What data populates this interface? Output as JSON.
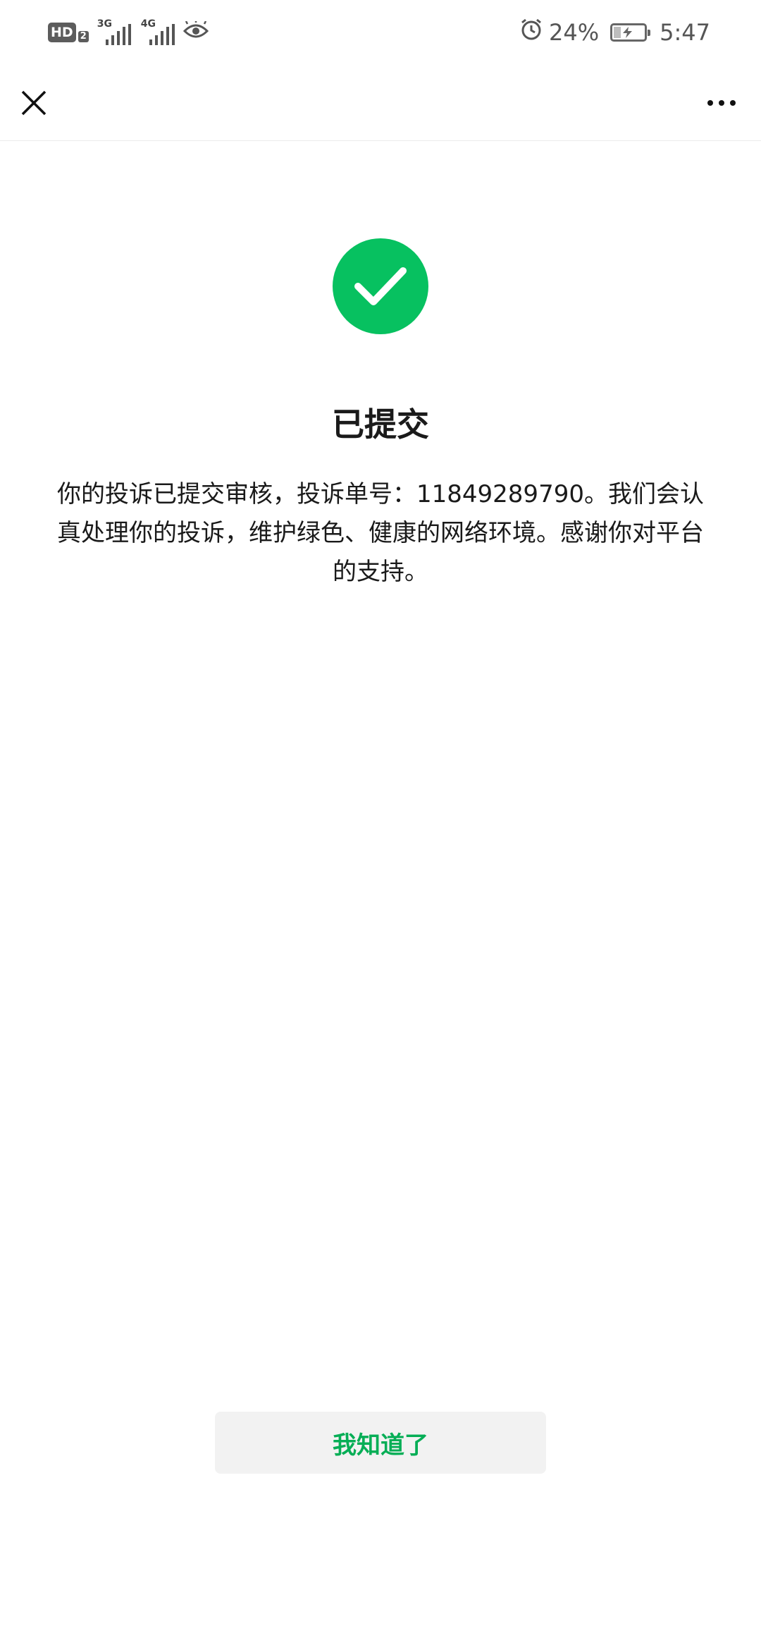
{
  "status_bar": {
    "hd_label": "HD",
    "hd_sim": "2",
    "sim1_network": "3G",
    "sim2_network": "4G",
    "battery_percent": "24%",
    "battery_level": 0.24,
    "time": "5:47",
    "icons": [
      "hd-icon",
      "signal-icon",
      "signal-icon",
      "eye-icon",
      "alarm-icon",
      "battery-charging-icon"
    ]
  },
  "nav": {
    "close_icon": "close-icon",
    "more_icon": "more-icon"
  },
  "result": {
    "icon": "success-check-icon",
    "icon_color": "#07c160",
    "title": "已提交",
    "message": "你的投诉已提交审核，投诉单号：11849289790。我们会认真处理你的投诉，维护绿色、健康的网络环境。感谢你对平台的支持。"
  },
  "footer": {
    "ack_label": "我知道了",
    "ack_color": "#06ae56"
  }
}
